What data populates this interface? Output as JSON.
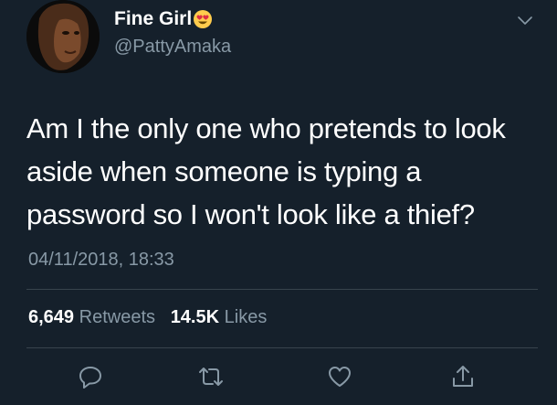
{
  "user": {
    "display_name": "Fine Girl",
    "emoji": "smiling-face-with-heart-eyes",
    "handle": "@PattyAmaka"
  },
  "tweet": {
    "text": "Am I the only one who pretends to look aside when someone is typing a password so I won't look like a thief?",
    "timestamp": "04/11/2018, 18:33"
  },
  "stats": {
    "retweets_count": "6,649",
    "retweets_label": "Retweets",
    "likes_count": "14.5K",
    "likes_label": "Likes"
  },
  "actions": [
    "reply-icon",
    "retweet-icon",
    "like-icon",
    "share-icon"
  ],
  "colors": {
    "background": "#15202b",
    "text": "#ffffff",
    "secondary_text": "#8899a6",
    "divider": "#38444d",
    "icon": "#8899a6"
  }
}
